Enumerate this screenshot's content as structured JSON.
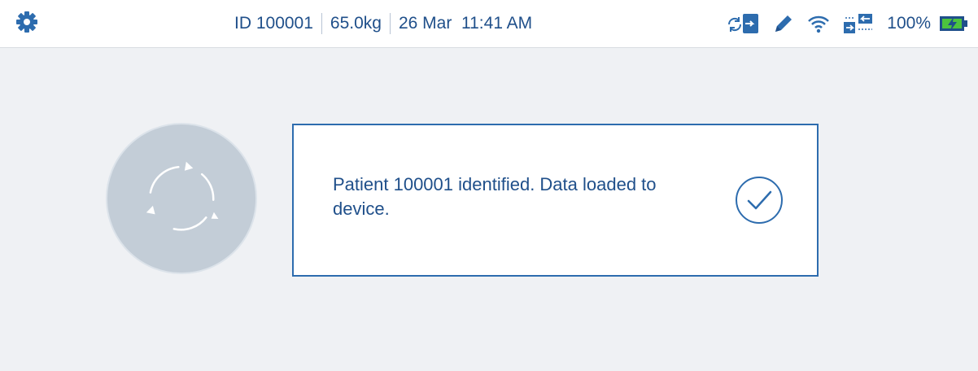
{
  "colors": {
    "accent": "#2d6cae",
    "text": "#1f4f8a",
    "background": "#eff1f4",
    "sync_circle": "#c3cdd7",
    "battery_fill": "#4cc43e"
  },
  "status_bar": {
    "settings_icon": "gear-icon",
    "patient_id": "ID 100001",
    "weight": "65.0kg",
    "datetime": "26 Mar  11:41 AM",
    "icons": [
      "sync-device-icon",
      "pencil-icon",
      "wifi-icon",
      "transfer-icon",
      "battery-charging-icon"
    ],
    "battery": "100%"
  },
  "main": {
    "sync_icon": "sync-arrows-icon",
    "message": "Patient 100001 identified. Data loaded to device.",
    "confirm_icon": "check-circle-icon"
  }
}
